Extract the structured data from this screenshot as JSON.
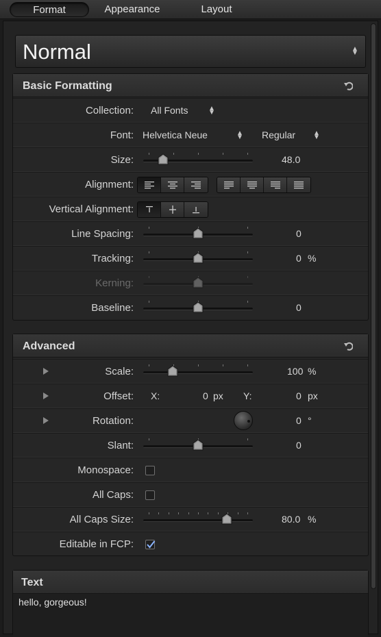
{
  "tabs": [
    {
      "label": "Format",
      "active": true
    },
    {
      "label": "Appearance",
      "active": false
    },
    {
      "label": "Layout",
      "active": false
    }
  ],
  "preset": {
    "value": "Normal"
  },
  "basic_formatting": {
    "title": "Basic Formatting",
    "collection": {
      "label": "Collection:",
      "value": "All Fonts"
    },
    "font": {
      "label": "Font:",
      "family": "Helvetica Neue",
      "style": "Regular"
    },
    "size": {
      "label": "Size:",
      "value": "48.0",
      "slider_fraction": 0.18
    },
    "alignment": {
      "label": "Alignment:",
      "options": [
        "align-left",
        "align-center",
        "align-right",
        "justify-left",
        "justify-center",
        "justify-right",
        "justify-full"
      ],
      "selected": "align-left"
    },
    "vertical_alignment": {
      "label": "Vertical Alignment:",
      "options": [
        "top",
        "middle",
        "bottom"
      ],
      "selected": "top"
    },
    "line_spacing": {
      "label": "Line Spacing:",
      "value": "0",
      "slider_fraction": 0.5
    },
    "tracking": {
      "label": "Tracking:",
      "value": "0",
      "unit": "%",
      "slider_fraction": 0.5
    },
    "kerning": {
      "label": "Kerning:",
      "slider_fraction": 0.5,
      "enabled": false
    },
    "baseline": {
      "label": "Baseline:",
      "value": "0",
      "slider_fraction": 0.5
    }
  },
  "advanced": {
    "title": "Advanced",
    "scale": {
      "label": "Scale:",
      "value": "100",
      "unit": "%",
      "slider_fraction": 0.27
    },
    "offset": {
      "label": "Offset:",
      "x_label": "X:",
      "x_value": "0",
      "y_label": "Y:",
      "y_value": "0",
      "unit": "px"
    },
    "rotation": {
      "label": "Rotation:",
      "value": "0",
      "unit": "°"
    },
    "slant": {
      "label": "Slant:",
      "value": "0",
      "slider_fraction": 0.5
    },
    "monospace": {
      "label": "Monospace:",
      "checked": false
    },
    "all_caps": {
      "label": "All Caps:",
      "checked": false
    },
    "all_caps_size": {
      "label": "All Caps Size:",
      "value": "80.0",
      "unit": "%",
      "slider_fraction": 0.76
    },
    "editable_in_fcp": {
      "label": "Editable in FCP:",
      "checked": true
    }
  },
  "text_panel": {
    "title": "Text",
    "content": "hello, gorgeous!"
  }
}
